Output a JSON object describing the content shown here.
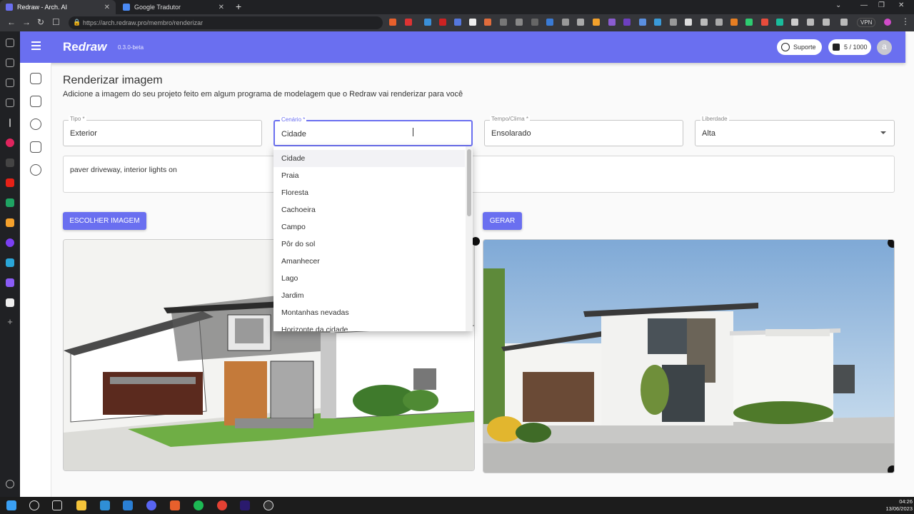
{
  "browser": {
    "tabs": [
      {
        "title": "Redraw - Arch. AI",
        "active": true
      },
      {
        "title": "Google Tradutor",
        "active": false
      }
    ],
    "url": "https://arch.redraw.pro/membro/renderizar",
    "vpn_label": "VPN"
  },
  "app": {
    "logo_prefix": "Re",
    "logo_suffix": "draw",
    "version": "0.3.0-beta",
    "support_label": "Suporte",
    "credits": "5 / 1000",
    "avatar_initial": "a",
    "accent_color": "#6a6ff0"
  },
  "page": {
    "title": "Renderizar imagem",
    "subtitle": "Adicione a imagem do seu projeto feito em algum programa de modelagem que o Redraw vai renderizar para você"
  },
  "fields": {
    "tipo": {
      "label": "Tipo *",
      "value": "Exterior"
    },
    "cenario": {
      "label": "Cenário *",
      "value": "Cidade"
    },
    "tempo": {
      "label": "Tempo/Clima *",
      "value": "Ensolarado"
    },
    "liberdade": {
      "label": "Liberdade",
      "value": "Alta"
    }
  },
  "prompt_text": "paver driveway, interior lights on",
  "buttons": {
    "choose_image": "ESCOLHER IMAGEM",
    "generate": "GERAR"
  },
  "dropdown_options": [
    "Cidade",
    "Praia",
    "Floresta",
    "Cachoeira",
    "Campo",
    "Pôr do sol",
    "Amanhecer",
    "Lago",
    "Jardim",
    "Montanhas nevadas",
    "Horizonte da cidade"
  ],
  "taskbar": {
    "time": "04:26",
    "date": "13/06/2023"
  }
}
